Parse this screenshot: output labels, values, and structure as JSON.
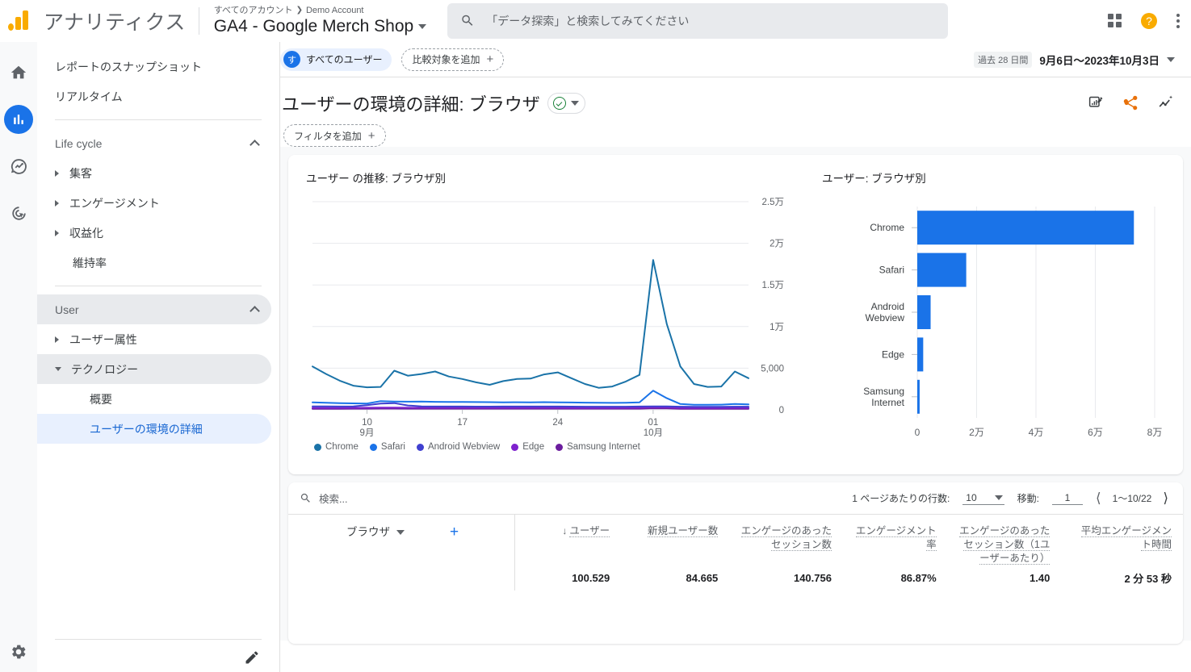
{
  "header": {
    "brand": "アナリティクス",
    "account_breadcrumb_root": "すべてのアカウント",
    "account_breadcrumb_sep": "❯",
    "account_breadcrumb_name": "Demo Account",
    "property_title": "GA4 - Google Merch Shop",
    "search_placeholder": "「データ探索」と検索してみてください",
    "apps_icon": "grid-apps-icon",
    "help_icon": "help-question-icon",
    "more_icon": "kebab-more-icon"
  },
  "rail": {
    "items": [
      {
        "name": "home",
        "icon": "home-icon",
        "active": false
      },
      {
        "name": "reports",
        "icon": "bar-chart-icon",
        "active": true
      },
      {
        "name": "explore",
        "icon": "explore-trend-icon",
        "active": false
      },
      {
        "name": "advertising",
        "icon": "advertising-target-icon",
        "active": false
      }
    ],
    "settings_icon": "gear-icon"
  },
  "sidebar": {
    "top_items": [
      {
        "label": "レポートのスナップショット"
      },
      {
        "label": "リアルタイム"
      }
    ],
    "groups": [
      {
        "label": "Life cycle",
        "items": [
          {
            "label": "集客",
            "expandable": true
          },
          {
            "label": "エンゲージメント",
            "expandable": true
          },
          {
            "label": "収益化",
            "expandable": true
          },
          {
            "label": "維持率",
            "expandable": false
          }
        ]
      },
      {
        "label": "User",
        "items": [
          {
            "label": "ユーザー属性",
            "expandable": true
          },
          {
            "label": "テクノロジー",
            "expandable": true,
            "expanded": true,
            "children": [
              {
                "label": "概要",
                "selected": false
              },
              {
                "label": "ユーザーの環境の詳細",
                "selected": true
              }
            ]
          }
        ]
      }
    ],
    "edit_icon": "pencil-edit-icon"
  },
  "filterbar": {
    "segment_avatar": "す",
    "segment_label": "すべてのユーザー",
    "add_comparison_label": "比較対象を追加",
    "plus": "+",
    "date_badge": "過去 28 日間",
    "date_range": "9月6日〜2023年10月3日"
  },
  "page": {
    "title": "ユーザーの環境の詳細: ブラウザ",
    "add_filter_label": "フィルタを追加",
    "actions": [
      {
        "name": "customize-report-icon"
      },
      {
        "name": "share-icon"
      },
      {
        "name": "insights-icon"
      }
    ]
  },
  "table": {
    "search_placeholder": "検索...",
    "rows_per_page_label": "1 ページあたりの行数:",
    "rows_per_page_value": "10",
    "goto_label": "移動:",
    "goto_value": "1",
    "range_label": "1〜10/22",
    "dimension_header": "ブラウザ",
    "columns": [
      "ユーザー",
      "新規ユーザー数",
      "エンゲージのあったセッション数",
      "エンゲージメント率",
      "エンゲージのあったセッション数（1ユーザーあたり）",
      "平均エンゲージメント時間"
    ],
    "totals": [
      "100.529",
      "84.665",
      "140.756",
      "86.87%",
      "1.40",
      "2 分 53 秒"
    ]
  },
  "chart_data": [
    {
      "type": "line",
      "title": "ユーザー の推移: ブラウザ別",
      "xlabel": "",
      "ylabel": "",
      "ylim": [
        0,
        25000
      ],
      "yticks": [
        0,
        5000,
        10000,
        15000,
        20000,
        25000
      ],
      "ytick_labels": [
        "0",
        "5,000",
        "1万",
        "1.5万",
        "2万",
        "2.5万"
      ],
      "xtick_positions": [
        4,
        11,
        18,
        25
      ],
      "xtick_labels": [
        "10",
        "17",
        "24",
        "01"
      ],
      "xtick_sublabels": [
        "9月",
        "",
        "",
        "10月"
      ],
      "grid": true,
      "legend_position": "bottom",
      "series": [
        {
          "name": "Chrome",
          "color": "#1a73a8",
          "values": [
            5200,
            4300,
            3500,
            2900,
            2700,
            2750,
            4700,
            4100,
            4300,
            4600,
            4000,
            3700,
            3300,
            3000,
            3450,
            3700,
            3750,
            4250,
            4500,
            3800,
            3100,
            2650,
            2800,
            3400,
            4200,
            18000,
            10300,
            5200,
            3100,
            2750,
            2800,
            4600,
            3800
          ]
        },
        {
          "name": "Safari",
          "color": "#1a73e8",
          "values": [
            900,
            850,
            800,
            780,
            760,
            1050,
            1000,
            980,
            1000,
            960,
            950,
            940,
            930,
            920,
            900,
            910,
            900,
            920,
            900,
            880,
            860,
            840,
            830,
            850,
            900,
            2300,
            1400,
            700,
            600,
            600,
            620,
            700,
            650
          ]
        },
        {
          "name": "Android Webview",
          "color": "#4040d0",
          "values": [
            420,
            410,
            400,
            420,
            560,
            750,
            800,
            520,
            420,
            400,
            400,
            400,
            390,
            390,
            400,
            400,
            400,
            400,
            400,
            390,
            380,
            380,
            380,
            380,
            400,
            420,
            420,
            380,
            360,
            360,
            360,
            380,
            380
          ]
        },
        {
          "name": "Edge",
          "color": "#7e22ce",
          "values": [
            230,
            230,
            230,
            240,
            250,
            260,
            260,
            250,
            245,
            245,
            245,
            240,
            240,
            240,
            240,
            240,
            240,
            240,
            240,
            235,
            235,
            235,
            235,
            240,
            250,
            320,
            300,
            230,
            220,
            220,
            220,
            230,
            230
          ]
        },
        {
          "name": "Samsung Internet",
          "color": "#6b1d9e",
          "values": [
            130,
            130,
            130,
            135,
            140,
            145,
            145,
            140,
            138,
            138,
            138,
            135,
            135,
            135,
            135,
            135,
            135,
            135,
            135,
            132,
            132,
            132,
            132,
            135,
            140,
            180,
            170,
            130,
            125,
            125,
            125,
            130,
            130
          ]
        }
      ]
    },
    {
      "type": "bar",
      "orientation": "horizontal",
      "title": "ユーザー: ブラウザ別",
      "categories": [
        "Chrome",
        "Safari",
        "Android Webview",
        "Edge",
        "Samsung Internet"
      ],
      "values": [
        73000,
        16500,
        4500,
        2000,
        800
      ],
      "bar_color": "#1a73e8",
      "xlim": [
        0,
        80000
      ],
      "xticks": [
        0,
        20000,
        40000,
        60000,
        80000
      ],
      "xtick_labels": [
        "0",
        "2万",
        "4万",
        "6万",
        "8万"
      ],
      "grid": true
    }
  ],
  "colors": {
    "accent": "#1a73e8",
    "selected_bg": "#e8f0fe",
    "canvas_bg": "#f8f9fa",
    "border": "#e0e0e0"
  }
}
